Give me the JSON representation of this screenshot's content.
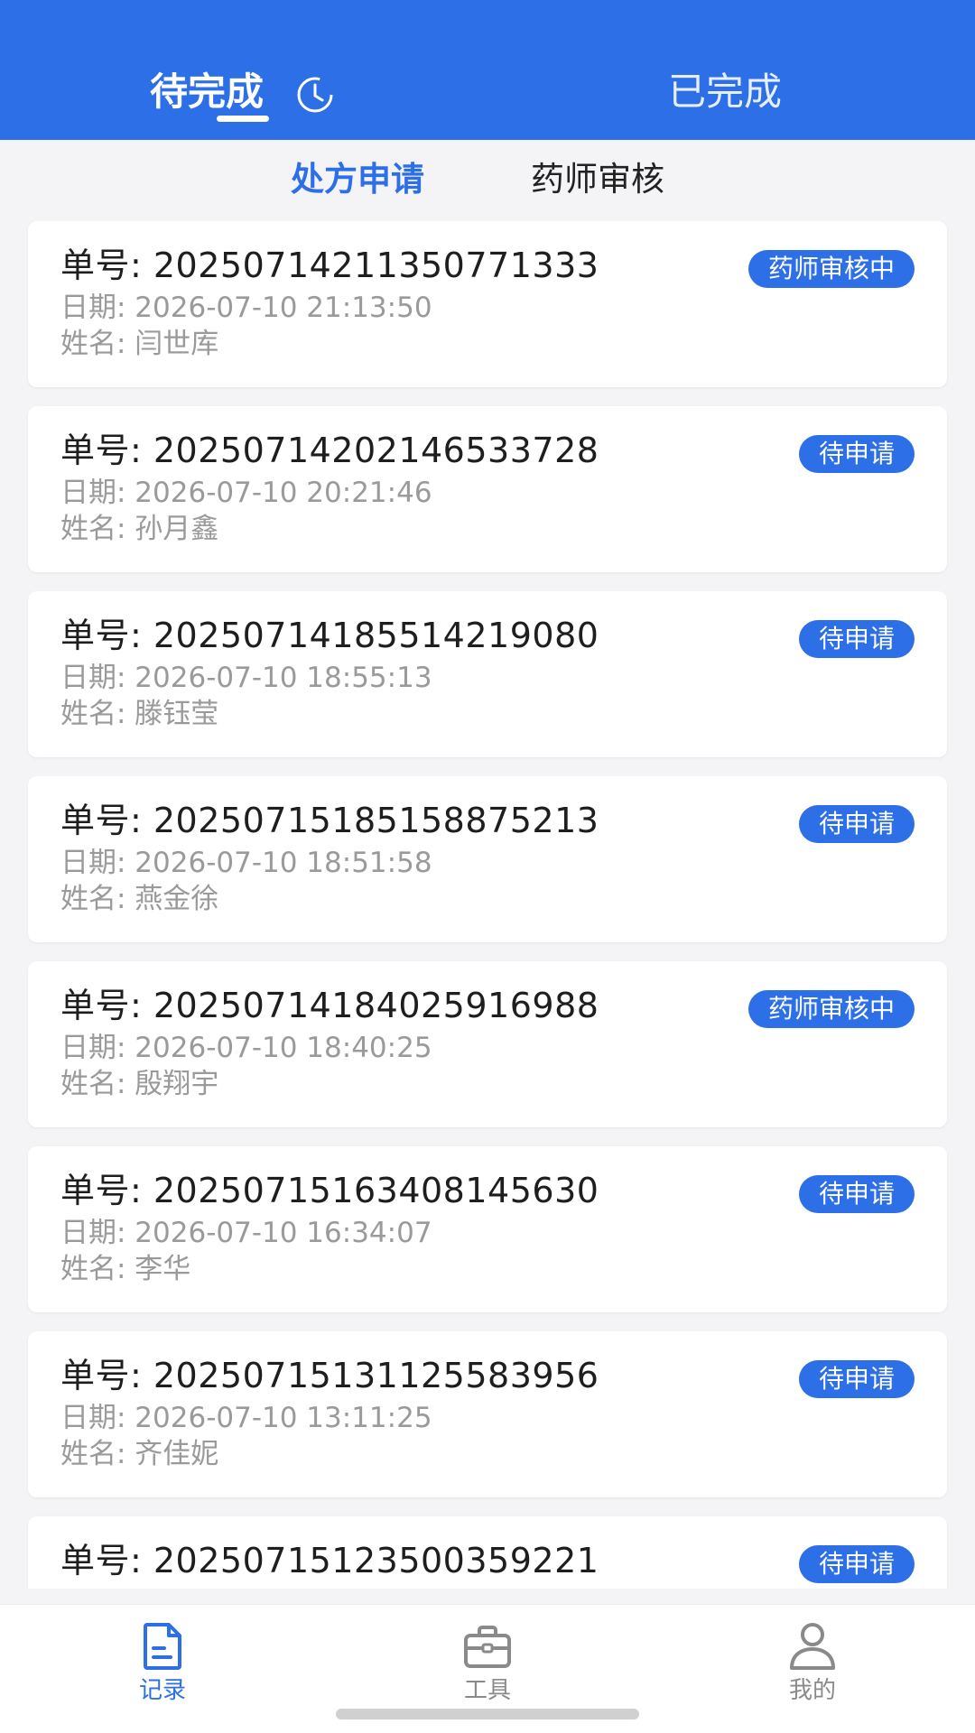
{
  "top_tabs": {
    "active": "待完成",
    "inactive": "已完成"
  },
  "sub_tabs": {
    "active": "处方申请",
    "inactive": "药师审核"
  },
  "records": [
    {
      "order": "单号: 20250714211350771333",
      "date": "日期: 2026-07-10 21:13:50",
      "name": "姓名: 闫世库",
      "status": "药师审核中"
    },
    {
      "order": "单号: 20250714202146533728",
      "date": "日期: 2026-07-10 20:21:46",
      "name": "姓名: 孙月鑫",
      "status": "待申请"
    },
    {
      "order": "单号: 20250714185514219080",
      "date": "日期: 2026-07-10 18:55:13",
      "name": "姓名: 滕钰莹",
      "status": "待申请"
    },
    {
      "order": "单号: 20250715185158875213",
      "date": "日期: 2026-07-10 18:51:58",
      "name": "姓名: 燕金徐",
      "status": "待申请"
    },
    {
      "order": "单号: 20250714184025916988",
      "date": "日期: 2026-07-10 18:40:25",
      "name": "姓名: 殷翔宇",
      "status": "药师审核中"
    },
    {
      "order": "单号: 20250715163408145630",
      "date": "日期: 2026-07-10 16:34:07",
      "name": "姓名: 李华",
      "status": "待申请"
    },
    {
      "order": "单号: 20250715131125583956",
      "date": "日期: 2026-07-10 13:11:25",
      "name": "姓名: 齐佳妮",
      "status": "待申请"
    },
    {
      "order": "单号: 20250715123500359221",
      "date": "",
      "name": "",
      "status": "待申请"
    }
  ],
  "bottom_nav": {
    "records": "记录",
    "tools": "工具",
    "mine": "我的"
  },
  "colors": {
    "primary": "#2d6fe6",
    "background": "#f4f4f6"
  },
  "icons": {
    "header": "clock-icon",
    "nav": [
      "document-icon",
      "briefcase-icon",
      "user-icon"
    ]
  }
}
